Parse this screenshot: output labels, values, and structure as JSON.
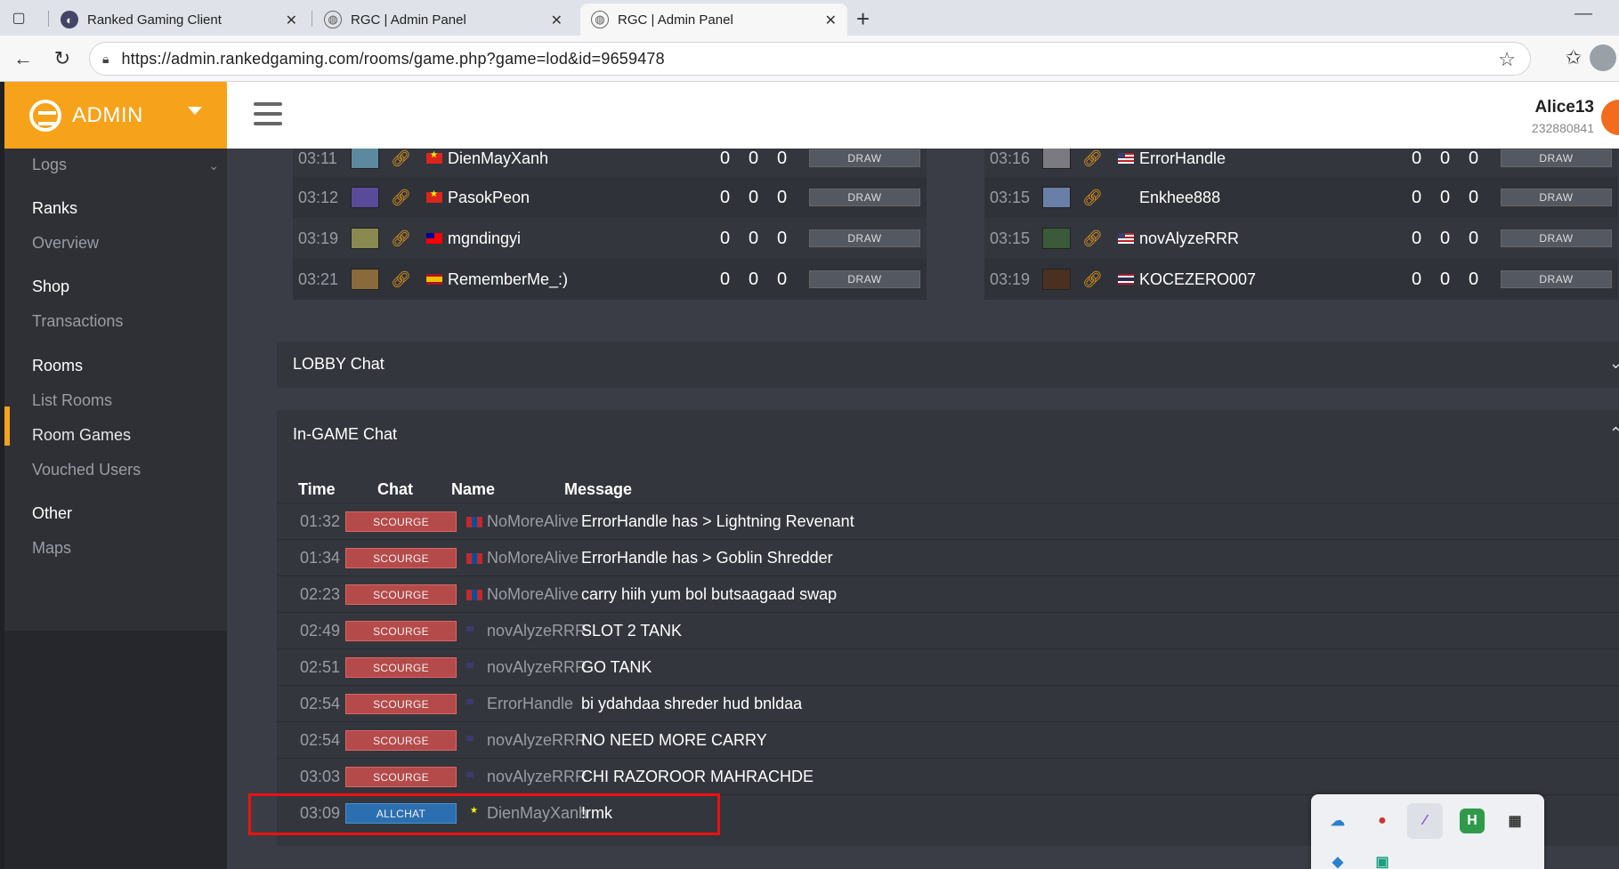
{
  "browser": {
    "tabs": [
      {
        "title": "Ranked Gaming Client"
      },
      {
        "title": "RGC | Admin Panel"
      },
      {
        "title": "RGC | Admin Panel"
      }
    ],
    "url": "https://admin.rankedgaming.com/rooms/game.php?game=lod&id=9659478"
  },
  "brand": {
    "label": "ADMIN",
    "color": "#f7a21b"
  },
  "user": {
    "name": "Alice13",
    "id": "232880841"
  },
  "sidebar": {
    "logs": "Logs",
    "ranks": "Ranks",
    "overview": "Overview",
    "shop": "Shop",
    "transactions": "Transactions",
    "rooms": "Rooms",
    "list_rooms": "List Rooms",
    "room_games": "Room Games",
    "vouched_users": "Vouched Users",
    "other": "Other",
    "maps": "Maps"
  },
  "players_left": [
    {
      "time": "03:11",
      "color": "#5b8aa0",
      "flag": "vn",
      "name": "DienMayXanh",
      "s1": "0",
      "s2": "0",
      "s3": "0",
      "btn": "DRAW"
    },
    {
      "time": "03:12",
      "color": "#5a4a9a",
      "flag": "vn",
      "name": "PasokPeon",
      "s1": "0",
      "s2": "0",
      "s3": "0",
      "btn": "DRAW"
    },
    {
      "time": "03:19",
      "color": "#8a8a50",
      "flag": "tw",
      "name": "mgndingyi",
      "s1": "0",
      "s2": "0",
      "s3": "0",
      "btn": "DRAW"
    },
    {
      "time": "03:21",
      "color": "#8a6a3a",
      "flag": "es",
      "name": "RememberMe_:)",
      "s1": "0",
      "s2": "0",
      "s3": "0",
      "btn": "DRAW"
    }
  ],
  "players_right": [
    {
      "time": "03:16",
      "color": "#7a7a80",
      "flag": "us",
      "name": "ErrorHandle",
      "s1": "0",
      "s2": "0",
      "s3": "0",
      "btn": "DRAW"
    },
    {
      "time": "03:15",
      "color": "#6a7fa8",
      "flag": "",
      "name": "Enkhee888",
      "s1": "0",
      "s2": "0",
      "s3": "0",
      "btn": "DRAW"
    },
    {
      "time": "03:15",
      "color": "#3a5a3a",
      "flag": "us",
      "name": "novAlyzeRRR",
      "s1": "0",
      "s2": "0",
      "s3": "0",
      "btn": "DRAW"
    },
    {
      "time": "03:19",
      "color": "#4a3020",
      "flag": "th",
      "name": "KOCEZERO007",
      "s1": "0",
      "s2": "0",
      "s3": "0",
      "btn": "DRAW"
    }
  ],
  "lobby_chat": {
    "title": "LOBBY Chat"
  },
  "ingame_chat": {
    "title": "In-GAME Chat",
    "headers": {
      "time": "Time",
      "chat": "Chat",
      "name": "Name",
      "message": "Message"
    },
    "rows": [
      {
        "time": "01:32",
        "chat": "SCOURGE",
        "flag": "mn",
        "name": "NoMoreAlive",
        "message": "ErrorHandle has > Lightning Revenant"
      },
      {
        "time": "01:34",
        "chat": "SCOURGE",
        "flag": "mn",
        "name": "NoMoreAlive",
        "message": "ErrorHandle has > Goblin Shredder"
      },
      {
        "time": "02:23",
        "chat": "SCOURGE",
        "flag": "mn",
        "name": "NoMoreAlive",
        "message": "carry hiih yum bol butsaagaad swap"
      },
      {
        "time": "02:49",
        "chat": "SCOURGE",
        "flag": "us",
        "name": "novAlyzeRRR",
        "message": "SLOT 2 TANK"
      },
      {
        "time": "02:51",
        "chat": "SCOURGE",
        "flag": "us",
        "name": "novAlyzeRRR",
        "message": "GO TANK"
      },
      {
        "time": "02:54",
        "chat": "SCOURGE",
        "flag": "us",
        "name": "ErrorHandle",
        "message": "bi ydahdaa shreder hud bnldaa"
      },
      {
        "time": "02:54",
        "chat": "SCOURGE",
        "flag": "us",
        "name": "novAlyzeRRR",
        "message": "NO NEED MORE CARRY"
      },
      {
        "time": "03:03",
        "chat": "SCOURGE",
        "flag": "us",
        "name": "novAlyzeRRR",
        "message": "CHI RAZOROOR MAHRACHDE"
      },
      {
        "time": "03:09",
        "chat": "ALLCHAT",
        "flag": "vn",
        "name": "DienMayXanh",
        "message": "!rmk"
      }
    ]
  },
  "tray": {
    "icons": [
      "cloud-icon",
      "record-icon",
      "feather-icon",
      "h-app-icon",
      "film-icon"
    ]
  }
}
